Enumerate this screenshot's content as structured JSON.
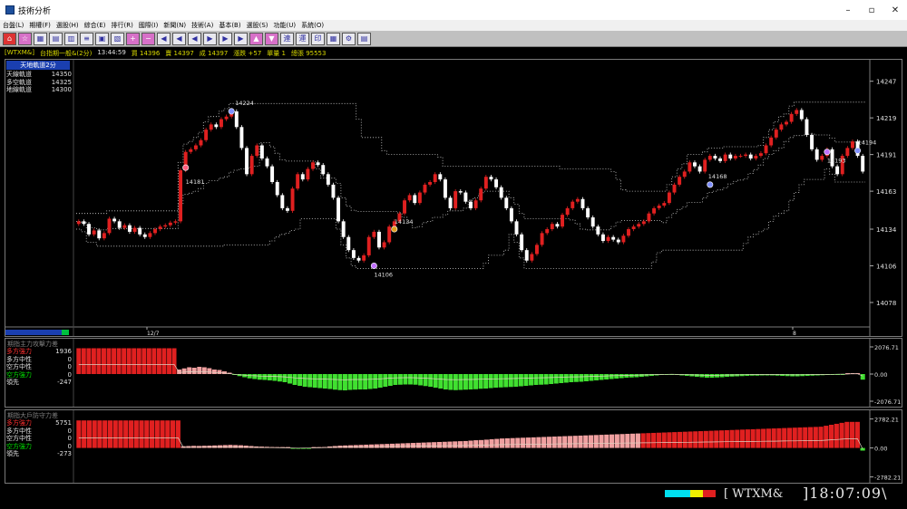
{
  "window": {
    "title": "技術分析",
    "minimize": "–",
    "maximize": "▫",
    "close": "✕"
  },
  "menu": [
    "台盤(L)",
    "期權(F)",
    "選股(H)",
    "綜合(E)",
    "排行(R)",
    "國際(I)",
    "新聞(N)",
    "技術(A)",
    "基本(B)",
    "選股(S)",
    "功能(U)",
    "系統(O)"
  ],
  "toolbar_icons": [
    {
      "name": "home-icon",
      "glyph": "⌂",
      "style": "red"
    },
    {
      "name": "star-icon",
      "glyph": "☆",
      "style": "pink"
    },
    {
      "name": "grid-icon",
      "glyph": "▦",
      "style": ""
    },
    {
      "name": "table-icon",
      "glyph": "▤",
      "style": ""
    },
    {
      "name": "book-icon",
      "glyph": "▥",
      "style": ""
    },
    {
      "name": "list-icon",
      "glyph": "≡",
      "style": ""
    },
    {
      "name": "doc-icon",
      "glyph": "▣",
      "style": ""
    },
    {
      "name": "chart-icon",
      "glyph": "▧",
      "style": ""
    },
    {
      "name": "add-icon",
      "glyph": "+",
      "style": "pink"
    },
    {
      "name": "minus-icon",
      "glyph": "−",
      "style": "pink"
    },
    {
      "name": "first-icon",
      "glyph": "◀",
      "style": ""
    },
    {
      "name": "prev-fast-icon",
      "glyph": "◀",
      "style": ""
    },
    {
      "name": "prev-icon",
      "glyph": "◀",
      "style": ""
    },
    {
      "name": "next-icon",
      "glyph": "▶",
      "style": ""
    },
    {
      "name": "next-fast-icon",
      "glyph": "▶",
      "style": ""
    },
    {
      "name": "last-icon",
      "glyph": "▶",
      "style": ""
    },
    {
      "name": "up-icon",
      "glyph": "▲",
      "style": "pink"
    },
    {
      "name": "down-icon",
      "glyph": "▼",
      "style": "pink"
    },
    {
      "name": "link-icon",
      "glyph": "連",
      "style": ""
    },
    {
      "name": "calc-icon",
      "glyph": "運",
      "style": ""
    },
    {
      "name": "print-icon",
      "glyph": "印",
      "style": ""
    },
    {
      "name": "book2-icon",
      "glyph": "▦",
      "style": ""
    },
    {
      "name": "settings-icon",
      "glyph": "⚙",
      "style": ""
    },
    {
      "name": "save-icon",
      "glyph": "▤",
      "style": ""
    }
  ],
  "info": {
    "symbol": "[WTXM&]",
    "name": "台指期一般&(2分)",
    "time": "13:44:59",
    "buy": "買 14396",
    "sell": "賣 14397",
    "deal": "成 14397",
    "change": "漲跌 +57",
    "vol": "單量 1",
    "total": "總張 95553"
  },
  "main": {
    "title": "天地軌道2分",
    "legend": [
      {
        "label": "天線軌道",
        "value": "14350",
        "color": "#e0e0e0"
      },
      {
        "label": "多空軌道",
        "value": "14325",
        "color": "#e0e0e0"
      },
      {
        "label": "地線軌道",
        "value": "14300",
        "color": "#e0e0e0"
      }
    ],
    "price_ticks": [
      "14247",
      "14219",
      "14191",
      "14163",
      "14134",
      "14106",
      "14078"
    ],
    "date_labels": [
      "12/7",
      "8"
    ],
    "annotations": [
      "14224",
      "14181",
      "14134",
      "14106",
      "14168",
      "14193",
      "14194"
    ]
  },
  "panel2": {
    "title": "期指主力攻擊力差",
    "legend": [
      {
        "label": "多方強力",
        "value": "1936",
        "color": "#ff3030"
      },
      {
        "label": "多方中性",
        "value": "0",
        "color": "#e0e0e0"
      },
      {
        "label": "空方中性",
        "value": "0",
        "color": "#e0e0e0"
      },
      {
        "label": "空方強力",
        "value": "0",
        "color": "#00e000"
      },
      {
        "label": "領先",
        "value": "-247",
        "color": "#e0e0e0"
      }
    ],
    "ticks": [
      "2076.71",
      "0.00",
      "-2076.71"
    ]
  },
  "panel3": {
    "title": "期指大戶防守力差",
    "legend": [
      {
        "label": "多方強力",
        "value": "5751",
        "color": "#ff3030"
      },
      {
        "label": "多方中性",
        "value": "0",
        "color": "#e0e0e0"
      },
      {
        "label": "空方中性",
        "value": "0",
        "color": "#e0e0e0"
      },
      {
        "label": "空方強力",
        "value": "0",
        "color": "#00e000"
      },
      {
        "label": "領先",
        "value": "-273",
        "color": "#e0e0e0"
      }
    ],
    "ticks": [
      "2782.21",
      "0.00",
      "-2782.21"
    ]
  },
  "status": {
    "symbol": "[ WTXM&",
    "time": "]18:07:09\\",
    "colors": [
      "#00e0f0",
      "#00e0f0",
      "#f0f000",
      "#e02020"
    ]
  },
  "chart_data": {
    "type": "candlestick",
    "y_ticks": [
      14247,
      14219,
      14191,
      14163,
      14134,
      14106,
      14078
    ],
    "ylim": [
      14060,
      14262
    ],
    "closes": [
      14140,
      14138,
      14130,
      14133,
      14127,
      14131,
      14142,
      14140,
      14135,
      14137,
      14132,
      14135,
      14130,
      14128,
      14131,
      14134,
      14136,
      14137,
      14139,
      14140,
      14179,
      14193,
      14195,
      14198,
      14202,
      14210,
      14214,
      14212,
      14218,
      14220,
      14224,
      14212,
      14196,
      14176,
      14190,
      14198,
      14188,
      14182,
      14170,
      14160,
      14150,
      14148,
      14165,
      14176,
      14172,
      14180,
      14185,
      14183,
      14176,
      14168,
      14158,
      14140,
      14128,
      14118,
      14112,
      14110,
      14114,
      14128,
      14132,
      14120,
      14124,
      14136,
      14140,
      14146,
      14156,
      14160,
      14154,
      14162,
      14168,
      14170,
      14176,
      14172,
      14158,
      14150,
      14163,
      14162,
      14155,
      14150,
      14156,
      14165,
      14174,
      14172,
      14166,
      14158,
      14150,
      14140,
      14130,
      14118,
      14110,
      14115,
      14122,
      14131,
      14134,
      14138,
      14136,
      14145,
      14150,
      14155,
      14157,
      14150,
      14143,
      14136,
      14130,
      14125,
      14128,
      14126,
      14124,
      14129,
      14134,
      14136,
      14138,
      14140,
      14146,
      14150,
      14152,
      14154,
      14162,
      14168,
      14174,
      14178,
      14185,
      14182,
      14178,
      14187,
      14190,
      14188,
      14186,
      14191,
      14188,
      14190,
      14190,
      14191,
      14188,
      14190,
      14192,
      14198,
      14204,
      14210,
      14214,
      14216,
      14222,
      14225,
      14218,
      14206,
      14195,
      14187,
      14190,
      14195,
      14182,
      14176,
      14190,
      14196,
      14201,
      14190,
      14178
    ],
    "panel2_values": [
      1936,
      1936,
      1936,
      1936,
      1936,
      1936,
      1936,
      1936,
      1936,
      1936,
      1936,
      1936,
      1936,
      1936,
      1936,
      1936,
      1936,
      1936,
      1936,
      1936,
      200,
      250,
      300,
      280,
      320,
      300,
      260,
      200,
      180,
      120,
      60,
      -30,
      -90,
      -140,
      -190,
      -220,
      -250,
      -260,
      -280,
      -300,
      -330,
      -360,
      -420,
      -480,
      -520,
      -560,
      -580,
      -600,
      -620,
      -640,
      -660,
      -690,
      -710,
      -720,
      -700,
      -690,
      -680,
      -680,
      -660,
      -640,
      -600,
      -560,
      -520,
      -480,
      -470,
      -460,
      -460,
      -470,
      -500,
      -530,
      -560,
      -600,
      -640,
      -680,
      -700,
      -710,
      -700,
      -690,
      -680,
      -670,
      -650,
      -640,
      -620,
      -600,
      -590,
      -580,
      -570,
      -560,
      -540,
      -520,
      -500,
      -480,
      -470,
      -460,
      -440,
      -420,
      -400,
      -380,
      -360,
      -350,
      -340,
      -320,
      -300,
      -280,
      -260,
      -240,
      -220,
      -200,
      -180,
      -160,
      -150,
      -140,
      -120,
      -100,
      -80,
      -60,
      -40,
      -30,
      -20,
      -40,
      -60,
      -80,
      -100,
      -120,
      -140,
      -160,
      -160,
      -150,
      -140,
      -120,
      -110,
      -100,
      -90,
      -80,
      -70,
      -70,
      -60,
      -60,
      -60,
      -70,
      -80,
      -90,
      -100,
      -100,
      -90,
      -80,
      -70,
      -60,
      -50,
      -40,
      -30,
      -20,
      -10,
      0,
      30,
      20,
      -247
    ],
    "panel3_values": [
      5751,
      5751,
      5751,
      5751,
      5751,
      5751,
      5751,
      5751,
      5751,
      5751,
      5751,
      5751,
      5751,
      5751,
      5751,
      5751,
      5751,
      5751,
      5751,
      5751,
      180,
      200,
      220,
      210,
      230,
      240,
      260,
      280,
      300,
      320,
      300,
      280,
      240,
      200,
      160,
      140,
      120,
      100,
      80,
      60,
      40,
      -30,
      -50,
      -40,
      -30,
      20,
      60,
      100,
      160,
      200,
      240,
      260,
      280,
      300,
      320,
      340,
      360,
      380,
      400,
      420,
      440,
      460,
      480,
      500,
      520,
      540,
      560,
      580,
      600,
      620,
      640,
      660,
      680,
      700,
      720,
      760,
      800,
      820,
      860,
      900,
      940,
      980,
      1000,
      1020,
      1040,
      1060,
      1080,
      1100,
      1120,
      1140,
      1160,
      1180,
      1200,
      1220,
      1240,
      1260,
      1280,
      1300,
      1320,
      1340,
      1360,
      1380,
      1400,
      1420,
      1440,
      1460,
      1480,
      1500,
      1520,
      1540,
      1560,
      1580,
      1600,
      1620,
      1640,
      1660,
      1680,
      1700,
      1720,
      1740,
      1760,
      1780,
      1800,
      1820,
      1840,
      1860,
      1880,
      1900,
      1920,
      1940,
      1960,
      1980,
      2000,
      2020,
      2040,
      2060,
      2080,
      2100,
      2120,
      2140,
      2160,
      2180,
      2200,
      2300,
      2400,
      2500,
      2600,
      2700,
      2700,
      2700,
      -273
    ]
  }
}
